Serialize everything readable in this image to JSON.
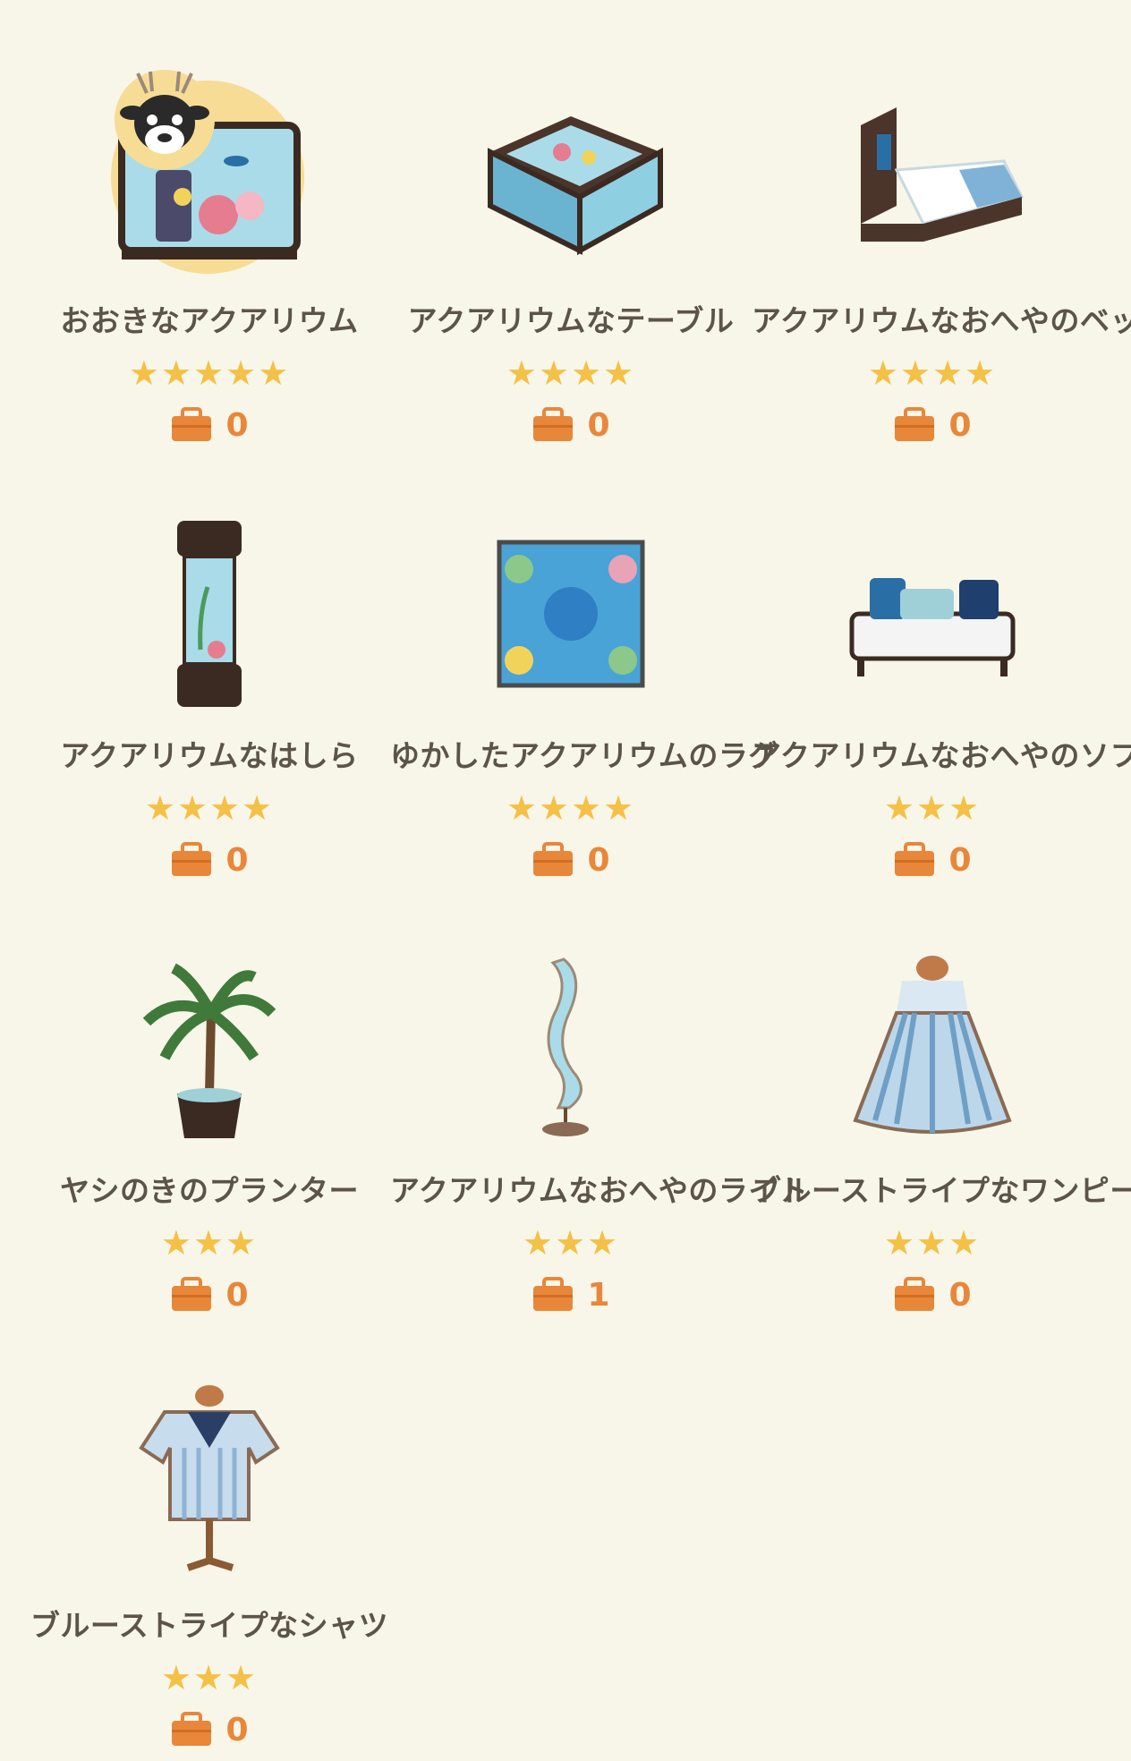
{
  "colors": {
    "background": "#f8f6e8",
    "name_text": "#5c534a",
    "star": "#f4c046",
    "bag": "#e8873a",
    "count": "#e8873a",
    "badge": "#f7dc96"
  },
  "items": [
    {
      "name": "おおきなアクアリウム",
      "stars": "★★★★★",
      "rating": 5,
      "count": "0",
      "icon": "large-aquarium-tank-icon",
      "badge": "deer-villager-avatar"
    },
    {
      "name": "アクアリウムなテーブル",
      "stars": "★★★★",
      "rating": 4,
      "count": "0",
      "icon": "aquarium-table-icon"
    },
    {
      "name": "アクアリウムなおへやのベッド",
      "stars": "★★★★",
      "rating": 4,
      "count": "0",
      "icon": "aquarium-bed-icon"
    },
    {
      "name": "アクアリウムなはしら",
      "stars": "★★★★",
      "rating": 4,
      "count": "0",
      "icon": "aquarium-pillar-icon"
    },
    {
      "name": "ゆかしたアクアリウムのラグ",
      "stars": "★★★★",
      "rating": 4,
      "count": "0",
      "icon": "aquarium-rug-icon"
    },
    {
      "name": "アクアリウムなおへやのソファ",
      "stars": "★★★",
      "rating": 3,
      "count": "0",
      "icon": "aquarium-sofa-icon"
    },
    {
      "name": "ヤシのきのプランター",
      "stars": "★★★",
      "rating": 3,
      "count": "0",
      "icon": "palm-planter-icon"
    },
    {
      "name": "アクアリウムなおへやのライト",
      "stars": "★★★",
      "rating": 3,
      "count": "1",
      "icon": "aquarium-light-icon"
    },
    {
      "name": "ブルーストライプなワンピース",
      "stars": "★★★",
      "rating": 3,
      "count": "0",
      "icon": "striped-dress-icon"
    },
    {
      "name": "ブルーストライプなシャツ",
      "stars": "★★★",
      "rating": 3,
      "count": "0",
      "icon": "striped-shirt-icon"
    }
  ]
}
